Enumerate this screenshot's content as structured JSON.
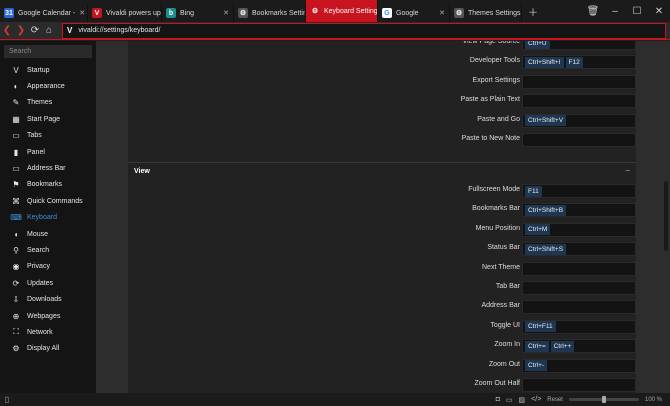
{
  "tabs": [
    {
      "title": "Google Calendar -",
      "icon": "google-calendar-icon",
      "color": "#2a67d4",
      "glyph": "31",
      "active": false
    },
    {
      "title": "Vivaldi powers up",
      "icon": "vivaldi-icon",
      "color": "#c8141e",
      "glyph": "V",
      "active": false
    },
    {
      "title": "Bing",
      "icon": "bing-icon",
      "color": "#1d8f8f",
      "glyph": "b",
      "active": false
    },
    {
      "title": "Bookmarks Setting",
      "icon": "settings-icon",
      "color": "#555555",
      "glyph": "⚙",
      "active": false
    },
    {
      "title": "Keyboard Settings",
      "icon": "settings-icon",
      "color": "#ffffff",
      "glyph": "⚙",
      "active": true
    },
    {
      "title": "Google",
      "icon": "google-icon",
      "color": "#ffffff",
      "glyph": "G",
      "active": false
    },
    {
      "title": "Themes Settings",
      "icon": "settings-icon",
      "color": "#555555",
      "glyph": "⚙",
      "active": false
    }
  ],
  "address": {
    "url": "vivaldi://settings/keyboard/",
    "logo": "V"
  },
  "sidebar": {
    "search_placeholder": "Search",
    "items": [
      {
        "label": "Startup",
        "icon": "startup-icon",
        "glyph": "V",
        "active": false
      },
      {
        "label": "Appearance",
        "icon": "appearance-icon",
        "glyph": "◐",
        "active": false
      },
      {
        "label": "Themes",
        "icon": "brush-icon",
        "glyph": "✎",
        "active": false
      },
      {
        "label": "Start Page",
        "icon": "start-page-icon",
        "glyph": "▦",
        "active": false
      },
      {
        "label": "Tabs",
        "icon": "tabs-icon",
        "glyph": "▭",
        "active": false
      },
      {
        "label": "Panel",
        "icon": "panel-icon",
        "glyph": "▮",
        "active": false
      },
      {
        "label": "Address Bar",
        "icon": "address-bar-icon",
        "glyph": "▭",
        "active": false
      },
      {
        "label": "Bookmarks",
        "icon": "bookmark-icon",
        "glyph": "⚑",
        "active": false
      },
      {
        "label": "Quick Commands",
        "icon": "quick-commands-icon",
        "glyph": "⌘",
        "active": false
      },
      {
        "label": "Keyboard",
        "icon": "keyboard-icon",
        "glyph": "⌨",
        "active": true
      },
      {
        "label": "Mouse",
        "icon": "mouse-icon",
        "glyph": "◖",
        "active": false
      },
      {
        "label": "Search",
        "icon": "search-icon",
        "glyph": "⚲",
        "active": false
      },
      {
        "label": "Privacy",
        "icon": "privacy-icon",
        "glyph": "◉",
        "active": false
      },
      {
        "label": "Updates",
        "icon": "updates-icon",
        "glyph": "⟳",
        "active": false
      },
      {
        "label": "Downloads",
        "icon": "downloads-icon",
        "glyph": "⇩",
        "active": false
      },
      {
        "label": "Webpages",
        "icon": "webpages-icon",
        "glyph": "⊕",
        "active": false
      },
      {
        "label": "Network",
        "icon": "network-icon",
        "glyph": "⛶",
        "active": false
      },
      {
        "label": "Display All",
        "icon": "gear-icon",
        "glyph": "⚙",
        "active": false
      }
    ]
  },
  "shortcuts_top": [
    {
      "label": "View Page Source",
      "keys": [
        "Ctrl+U"
      ]
    },
    {
      "label": "Developer Tools",
      "keys": [
        "Ctrl+Shift+I",
        "F12"
      ]
    },
    {
      "label": "Export Settings",
      "keys": []
    },
    {
      "label": "Paste as Plain Text",
      "keys": []
    },
    {
      "label": "Paste and Go",
      "keys": [
        "Ctrl+Shift+V"
      ]
    },
    {
      "label": "Paste to New Note",
      "keys": []
    }
  ],
  "view_section": {
    "title": "View",
    "collapse": "−",
    "rows": [
      {
        "label": "Fullscreen Mode",
        "keys": [
          "F11"
        ]
      },
      {
        "label": "Bookmarks Bar",
        "keys": [
          "Ctrl+Shift+B"
        ]
      },
      {
        "label": "Menu Position",
        "keys": [
          "Ctrl+M"
        ]
      },
      {
        "label": "Status Bar",
        "keys": [
          "Ctrl+Shift+S"
        ]
      },
      {
        "label": "Next Theme",
        "keys": []
      },
      {
        "label": "Tab Bar",
        "keys": []
      },
      {
        "label": "Address Bar",
        "keys": []
      },
      {
        "label": "Toggle UI",
        "keys": [
          "Ctrl+F11"
        ]
      },
      {
        "label": "Zoom In",
        "keys": [
          "Ctrl+=",
          "Ctrl++"
        ]
      },
      {
        "label": "Zoom Out",
        "keys": [
          "Ctrl+-"
        ]
      },
      {
        "label": "Zoom Out Half",
        "keys": []
      }
    ]
  },
  "statusbar": {
    "reset_label": "Reset",
    "zoom_label": "100 %",
    "zoom_level": 0.5
  }
}
